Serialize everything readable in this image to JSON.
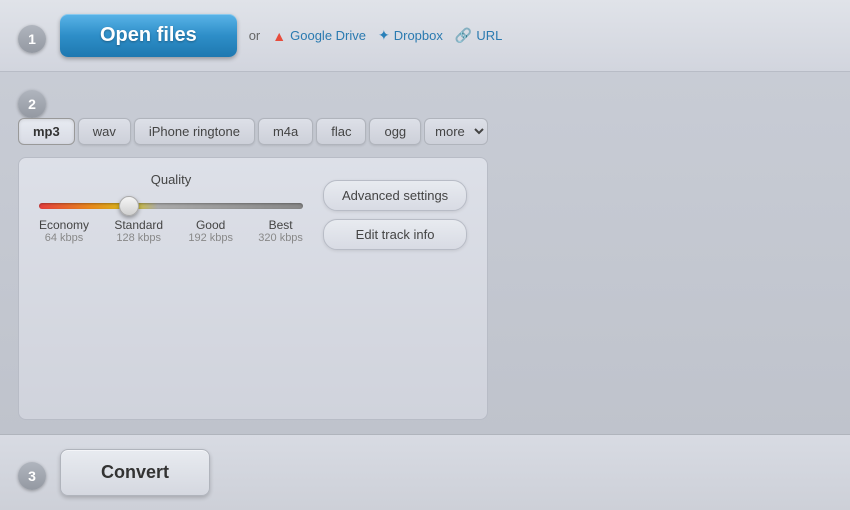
{
  "steps": {
    "step1": {
      "number": "1",
      "open_files_label": "Open files",
      "or_text": "or",
      "links": [
        {
          "name": "Google Drive",
          "icon": "gdrive"
        },
        {
          "name": "Dropbox",
          "icon": "dropbox"
        },
        {
          "name": "URL",
          "icon": "url"
        }
      ]
    },
    "step2": {
      "number": "2",
      "tabs": [
        {
          "id": "mp3",
          "label": "mp3",
          "active": true
        },
        {
          "id": "wav",
          "label": "wav",
          "active": false
        },
        {
          "id": "iphone",
          "label": "iPhone ringtone",
          "active": false
        },
        {
          "id": "m4a",
          "label": "m4a",
          "active": false
        },
        {
          "id": "flac",
          "label": "flac",
          "active": false
        },
        {
          "id": "ogg",
          "label": "ogg",
          "active": false
        }
      ],
      "more_label": "more",
      "quality": {
        "title": "Quality",
        "slider_value": 33,
        "labels": [
          {
            "name": "Economy",
            "kbps": "64 kbps"
          },
          {
            "name": "Standard",
            "kbps": "128 kbps"
          },
          {
            "name": "Good",
            "kbps": "192 kbps"
          },
          {
            "name": "Best",
            "kbps": "320 kbps"
          }
        ]
      },
      "buttons": {
        "advanced": "Advanced settings",
        "edit_track": "Edit track info"
      }
    },
    "step3": {
      "number": "3",
      "convert_label": "Convert"
    }
  }
}
